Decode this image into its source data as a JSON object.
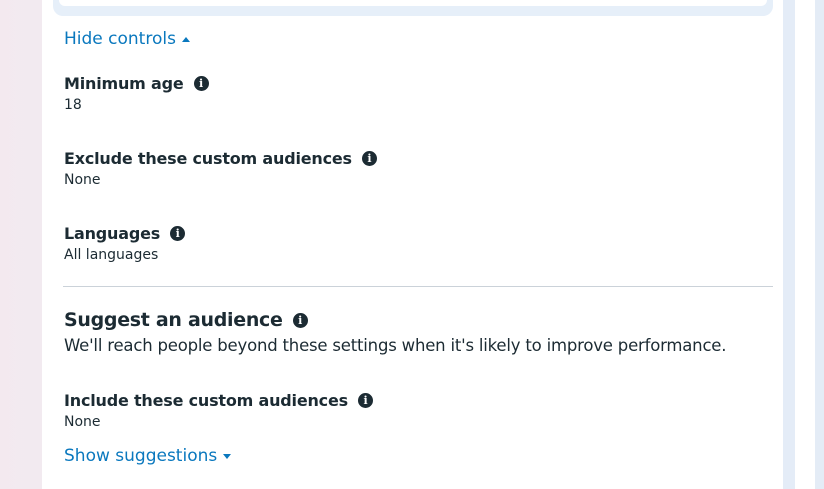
{
  "controls": {
    "hide_controls_label": "Hide controls",
    "show_suggestions_label": "Show suggestions"
  },
  "fields": {
    "minimum_age": {
      "title": "Minimum age",
      "value": "18"
    },
    "exclude_custom_audiences": {
      "title": "Exclude these custom audiences",
      "value": "None"
    },
    "languages": {
      "title": "Languages",
      "value": "All languages"
    }
  },
  "suggest": {
    "title": "Suggest an audience",
    "description": "We'll reach people beyond these settings when it's likely to improve performance.",
    "include_custom_audiences": {
      "title": "Include these custom audiences",
      "value": "None"
    }
  },
  "icons": {
    "info": "info-icon",
    "caret_up": "caret-up-icon",
    "caret_down": "caret-down-icon"
  },
  "colors": {
    "link": "#0a78be",
    "text": "#1c2b33",
    "divider": "#cbd2d9"
  }
}
